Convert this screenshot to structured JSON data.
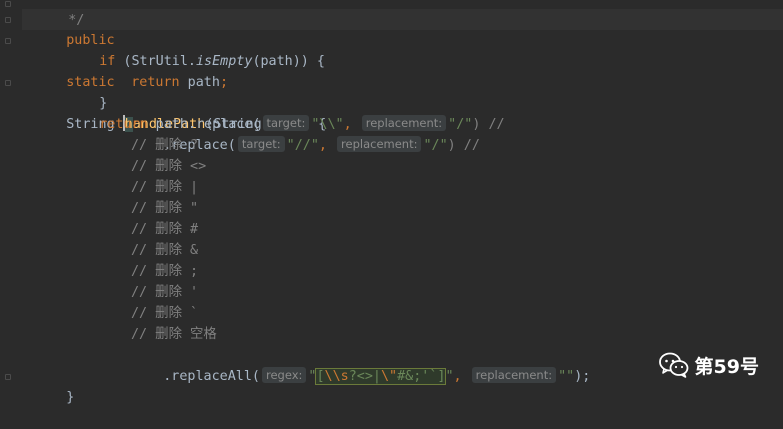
{
  "code": {
    "top_comment": "*/",
    "sig": {
      "kw_public": "public",
      "kw_static": "static",
      "ret_type": "String ",
      "name_rest": "andlePath",
      "name_first": "h",
      "params": "(String path) {"
    },
    "if_line": {
      "kw_if": "if",
      "open": " (StrUtil.",
      "method": "isEmpty",
      "close": "(path)) {"
    },
    "return_path": {
      "kw": "return",
      "rest": " path",
      "semi": ";"
    },
    "close_brace_inner": "}",
    "replace1": {
      "kw": "return",
      "call": " path.replace(",
      "hint_target": "target:",
      "arg1": "\"\\\\\"",
      "comma": ",",
      "hint_replacement": "replacement:",
      "arg2": "\"/\"",
      "tail": ") //"
    },
    "replace2": {
      "call": ".replace(",
      "hint_target": "target:",
      "arg1": "\"//\"",
      "comma": ",",
      "hint_replacement": "replacement:",
      "arg2": "\"/\"",
      "tail": ") //"
    },
    "comments": [
      "// 删除 ?",
      "// 删除 <>",
      "// 删除 |",
      "// 删除 \"",
      "// 删除 #",
      "// 删除 &",
      "// 删除 ;",
      "// 删除 '",
      "// 删除 `",
      "// 删除 空格"
    ],
    "replace_all": {
      "call": ".replaceAll(",
      "hint_regex": "regex:",
      "q_open": "\"",
      "bracket_open": "[",
      "esc1": "\\\\s",
      "chars1": "?<>|",
      "esc2": "\\\"",
      "chars2": "#&;'`",
      "bracket_close": "]",
      "q_close": "\"",
      "comma": ",",
      "hint_replacement": "replacement:",
      "arg2": "\"\"",
      "tail": ");"
    },
    "close_brace_outer": "}"
  },
  "watermark": {
    "text": "第59号",
    "icon": "wechat-icon"
  },
  "colors": {
    "background": "#2b2b2b",
    "keyword": "#cc7832",
    "string": "#6a8759",
    "comment": "#808080",
    "function": "#ffc66d",
    "default": "#a9b7c6"
  }
}
